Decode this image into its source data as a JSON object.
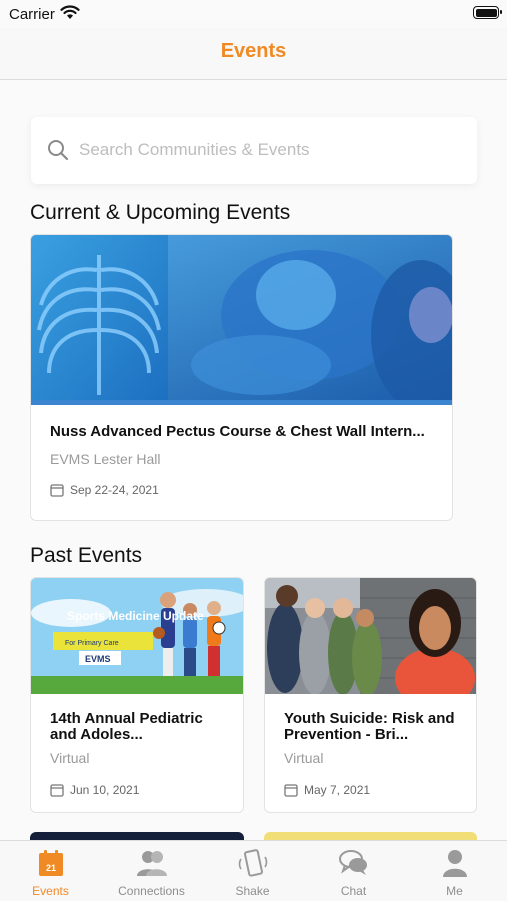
{
  "status_bar": {
    "carrier": "Carrier"
  },
  "nav": {
    "title": "Events"
  },
  "search": {
    "placeholder": "Search Communities & Events"
  },
  "sections": {
    "current": "Current & Upcoming Events",
    "past": "Past Events"
  },
  "current_events": [
    {
      "title": "Nuss Advanced Pectus Course & Chest Wall Intern...",
      "venue": "EVMS Lester Hall",
      "date": "Sep 22-24, 2021"
    }
  ],
  "past_events": [
    {
      "title": "14th Annual Pediatric and Adoles...",
      "venue": "Virtual",
      "date": "Jun 10, 2021",
      "banner": {
        "tagline": "Sports Medicine Update",
        "subtitle": "For Primary Care",
        "logo": "EVMS"
      }
    },
    {
      "title": "Youth Suicide: Risk and Prevention - Bri...",
      "venue": "Virtual",
      "date": "May 7, 2021"
    }
  ],
  "tabs": [
    {
      "label": "Events",
      "icon": "calendar-icon",
      "date_number": "21",
      "active": true
    },
    {
      "label": "Connections",
      "icon": "people-icon",
      "active": false
    },
    {
      "label": "Shake",
      "icon": "phone-shake-icon",
      "active": false
    },
    {
      "label": "Chat",
      "icon": "chat-bubbles-icon",
      "active": false
    },
    {
      "label": "Me",
      "icon": "person-icon",
      "active": false
    }
  ],
  "colors": {
    "accent": "#f08a24",
    "muted_text": "#9a9a9a",
    "tab_inactive": "#8e8e8e"
  }
}
